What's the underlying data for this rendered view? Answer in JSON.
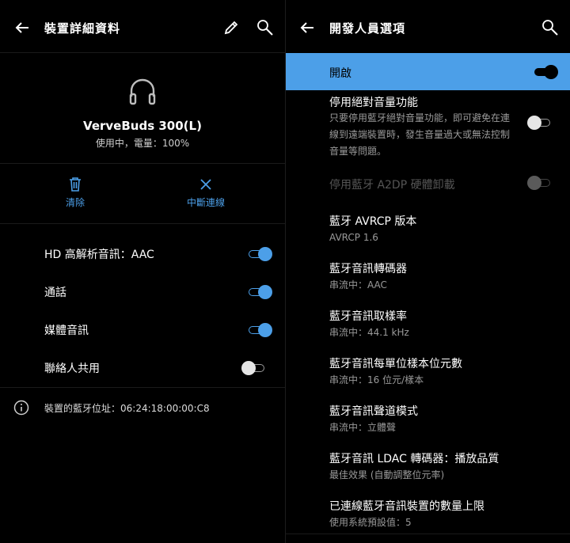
{
  "left": {
    "title": "裝置詳細資料",
    "device_name": "VerveBuds 300(L)",
    "device_status": "使用中，電量：100%",
    "actions": {
      "clear": "清除",
      "disconnect": "中斷連線"
    },
    "profiles": [
      {
        "label": "HD 高解析音訊：AAC",
        "on": true
      },
      {
        "label": "通話",
        "on": true
      },
      {
        "label": "媒體音訊",
        "on": true
      },
      {
        "label": "聯絡人共用",
        "on": false
      }
    ],
    "bt_address": "裝置的藍牙位址：06:24:18:00:00:C8"
  },
  "right": {
    "title": "開發人員選項",
    "master_label": "開啟",
    "items": [
      {
        "title": "停用絕對音量功能",
        "subtitle": "只要停用藍牙絕對音量功能，即可避免在連線到遠端裝置時，發生音量過大或無法控制音量等問題。"
      },
      {
        "title": "停用藍牙 A2DP 硬體卸載"
      },
      {
        "title": "藍牙 AVRCP 版本",
        "subtitle": "AVRCP 1.6"
      },
      {
        "title": "藍牙音訊轉碼器",
        "subtitle": "串流中：AAC"
      },
      {
        "title": "藍牙音訊取樣率",
        "subtitle": "串流中：44.1 kHz"
      },
      {
        "title": "藍牙音訊每單位樣本位元數",
        "subtitle": "串流中：16 位元/樣本"
      },
      {
        "title": "藍牙音訊聲道模式",
        "subtitle": "串流中：立體聲"
      },
      {
        "title": "藍牙音訊 LDAC 轉碼器：播放品質",
        "subtitle": "最佳效果 (自動調整位元率)"
      },
      {
        "title": "已連線藍牙音訊裝置的數量上限",
        "subtitle": "使用系統預設值：5"
      }
    ]
  },
  "colors": {
    "accent": "#4c9fe8",
    "background": "#000000"
  }
}
